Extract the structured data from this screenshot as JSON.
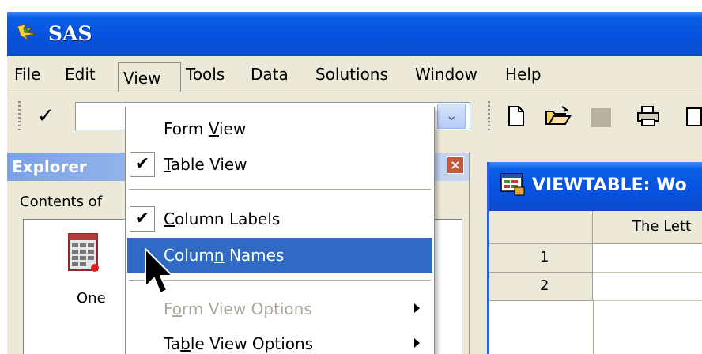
{
  "window": {
    "title": "SAS",
    "app_icon": "sas-logo-icon"
  },
  "menubar": [
    {
      "label": "File"
    },
    {
      "label": "Edit"
    },
    {
      "label": "View"
    },
    {
      "label": "Tools"
    },
    {
      "label": "Data"
    },
    {
      "label": "Solutions"
    },
    {
      "label": "Window"
    },
    {
      "label": "Help"
    }
  ],
  "toolbar": {
    "check_glyph": "✓",
    "command_value": "",
    "icons": [
      "new-document-icon",
      "open-folder-icon",
      "save-disabled-icon",
      "print-icon",
      "print-preview-icon"
    ]
  },
  "explorer": {
    "title": "Explorer",
    "close_glyph": "×",
    "contents_label": "Contents of",
    "library_label": "One"
  },
  "viewtable": {
    "title": "VIEWTABLE: Wo",
    "column_header": "The Lett",
    "rows": [
      "1",
      "2"
    ]
  },
  "view_menu": {
    "items": [
      {
        "pre": "Form ",
        "mnemonic": "V",
        "post": "iew",
        "checked": false,
        "enabled": true,
        "submenu": false
      },
      {
        "pre": "",
        "mnemonic": "T",
        "post": "able View",
        "checked": true,
        "enabled": true,
        "submenu": false
      },
      {
        "pre": "",
        "mnemonic": "C",
        "post": "olumn Labels",
        "checked": true,
        "enabled": true,
        "submenu": false
      },
      {
        "pre": "Colum",
        "mnemonic": "n",
        "post": " Names",
        "checked": false,
        "enabled": true,
        "submenu": false,
        "highlighted": true
      },
      {
        "pre": "F",
        "mnemonic": "o",
        "post": "rm View Options",
        "checked": false,
        "enabled": false,
        "submenu": true
      },
      {
        "pre": "Ta",
        "mnemonic": "b",
        "post": "le View Options",
        "checked": false,
        "enabled": true,
        "submenu": true
      }
    ],
    "check_glyph": "✔"
  },
  "colors": {
    "titlebar": "#0752df",
    "menu_highlight": "#316ac5",
    "chrome": "#ece9d8"
  }
}
